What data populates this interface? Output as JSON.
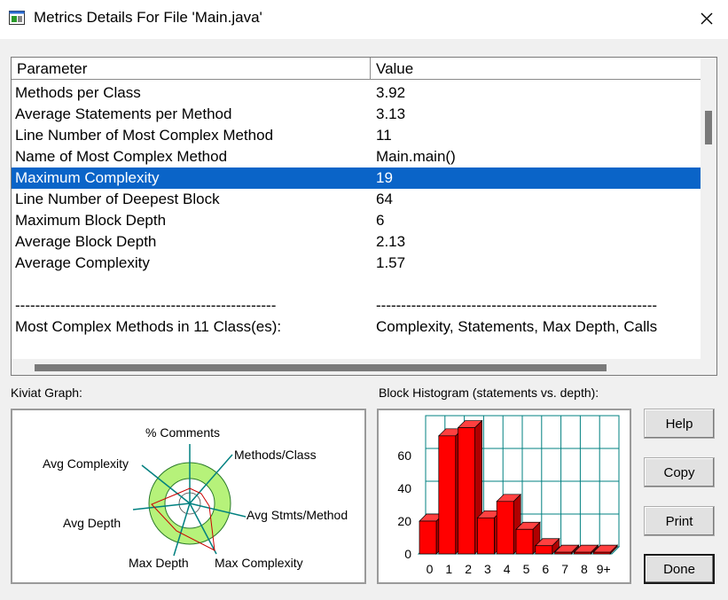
{
  "window": {
    "title": "Metrics Details For File 'Main.java'",
    "icon": "app-window-icon",
    "close_icon": "close-icon"
  },
  "table": {
    "columns": [
      "Parameter",
      "Value"
    ],
    "rows": [
      {
        "param": "Methods per Class",
        "value": "3.92",
        "selected": false
      },
      {
        "param": "Average Statements per Method",
        "value": "3.13",
        "selected": false
      },
      {
        "param": "Line Number of Most Complex Method",
        "value": "11",
        "selected": false
      },
      {
        "param": "Name of Most Complex Method",
        "value": "Main.main()",
        "selected": false
      },
      {
        "param": "Maximum Complexity",
        "value": "19",
        "selected": true
      },
      {
        "param": "Line Number of Deepest Block",
        "value": "64",
        "selected": false
      },
      {
        "param": "Maximum Block Depth",
        "value": "6",
        "selected": false
      },
      {
        "param": "Average Block Depth",
        "value": "2.13",
        "selected": false
      },
      {
        "param": "Average Complexity",
        "value": "1.57",
        "selected": false
      },
      {
        "param": "",
        "value": "",
        "selected": false
      },
      {
        "param": "----------------------------------------------------",
        "value": "--------------------------------------------------------",
        "selected": false
      },
      {
        "param": "Most Complex Methods in 11 Class(es):",
        "value": "Complexity, Statements, Max Depth, Calls",
        "selected": false
      }
    ]
  },
  "kiviat": {
    "label": "Kiviat Graph:",
    "axes": [
      "% Comments",
      "Methods/Class",
      "Avg Stmts/Method",
      "Max Complexity",
      "Max Depth",
      "Avg Depth",
      "Avg Complexity"
    ]
  },
  "histogram": {
    "label": "Block Histogram (statements vs. depth):",
    "y_ticks": [
      "0",
      "20",
      "40",
      "60"
    ],
    "x_labels": [
      "0",
      "1",
      "2",
      "3",
      "4",
      "5",
      "6",
      "7",
      "8",
      "9+"
    ],
    "values": [
      20,
      72,
      77,
      22,
      32,
      15,
      5,
      1,
      1,
      1
    ],
    "ylim": [
      0,
      80
    ],
    "bar_color": "#ff0000"
  },
  "buttons": {
    "help": "Help",
    "copy": "Copy",
    "print": "Print",
    "done": "Done"
  },
  "colors": {
    "selection": "#0a64c8",
    "kiviat_ring": "#b6f27a",
    "kiviat_axis": "#008080"
  }
}
